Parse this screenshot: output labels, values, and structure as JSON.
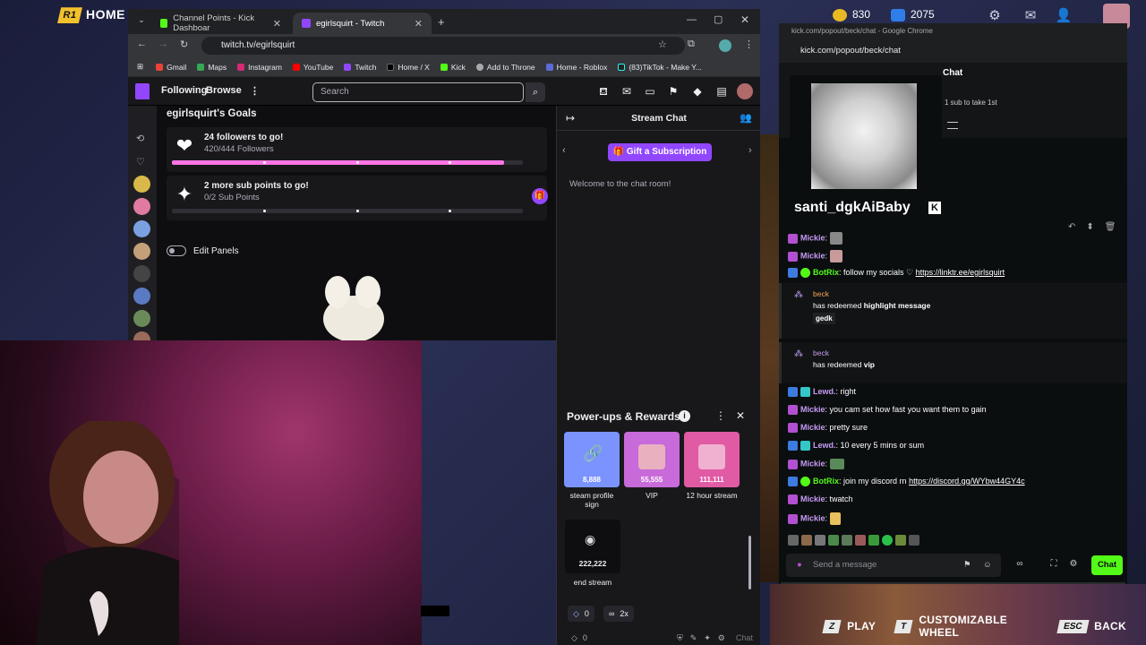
{
  "game": {
    "logo": "HOME",
    "coins": "830",
    "gems": "2075",
    "bottom_keys": [
      {
        "key": "Z",
        "label": "PLAY"
      },
      {
        "key": "T",
        "label": "CUSTOMIZABLE WHEEL"
      },
      {
        "key": "ESC",
        "label": "BACK"
      }
    ]
  },
  "browser": {
    "tabs": [
      {
        "title": "Channel Points - Kick Dashboar",
        "color": "#53fc18"
      },
      {
        "title": "egirlsquirt - Twitch",
        "color": "#9147ff"
      }
    ],
    "url": "twitch.tv/egirlsquirt",
    "bookmarks": [
      "Gmail",
      "Maps",
      "Instagram",
      "YouTube",
      "Twitch",
      "Home / X",
      "Kick",
      "Add to Throne",
      "Home - Roblox",
      "(83)TikTok - Make Y..."
    ]
  },
  "twitch": {
    "nav": {
      "following": "Following",
      "browse": "Browse",
      "search_placeholder": "Search"
    },
    "goals_title": "egirlsquirt's Goals",
    "goals": [
      {
        "title": "24 followers to go!",
        "sub": "420/444 Followers",
        "progress": 0.946
      },
      {
        "title": "2 more sub points to go!",
        "sub": "0/2 Sub Points",
        "progress": 0
      }
    ],
    "edit_panels": "Edit Panels",
    "chat": {
      "header": "Stream Chat",
      "gift": "Gift a Subscription",
      "welcome": "Welcome to the chat room!"
    },
    "powerups": {
      "title": "Power-ups & Rewards",
      "rewards": [
        {
          "cost": "8,888",
          "label": "steam profile sign"
        },
        {
          "cost": "55,555",
          "label": "VIP"
        },
        {
          "cost": "111,111",
          "label": "12 hour stream"
        },
        {
          "cost": "222,222",
          "label": "end stream"
        }
      ]
    },
    "bottom": {
      "points": "0",
      "multiplier": "2x",
      "points2": "0",
      "chat_btn": "Chat"
    }
  },
  "kick": {
    "window_title": "kick.com/popout/beck/chat - Google Chrome",
    "url": "kick.com/popout/beck/chat",
    "chat_title": "Chat",
    "sub_text": "1 sub to take 1st",
    "card_name": "santi_dgkAiBaby",
    "messages": [
      {
        "user": "Mickie",
        "text": ""
      },
      {
        "user": "Mickie",
        "text": ""
      },
      {
        "user": "BotRix",
        "text": "follow my socials ♡",
        "link": "https://linktr.ee/egirlsquirt"
      }
    ],
    "redeems": [
      {
        "user": "beck",
        "action": "has redeemed",
        "reward": "highlight message",
        "pill": "gedk"
      },
      {
        "user": "beck",
        "action": "has redeemed",
        "reward": "vip",
        "pill": ""
      }
    ],
    "messages2": [
      {
        "user": "Lewd.",
        "text": "right"
      },
      {
        "user": "Mickie",
        "text": "you cam set how fast you want them to gain"
      },
      {
        "user": "Mickie",
        "text": "pretty sure"
      },
      {
        "user": "Lewd.",
        "text": "10 every 5 mins or sum"
      },
      {
        "user": "Mickie",
        "text": ""
      },
      {
        "user": "BotRix",
        "text": "join my discord rn",
        "link": "https://discord.gg/WYbw44GY4c"
      },
      {
        "user": "Mickie",
        "text": "twatch"
      },
      {
        "user": "Mickie",
        "text": ""
      }
    ],
    "input_placeholder": "Send a message",
    "chat_btn": "Chat"
  },
  "colors": {
    "twitch": "#9147ff",
    "kick": "#53fc18",
    "pink_progress": "#ff75e6"
  }
}
